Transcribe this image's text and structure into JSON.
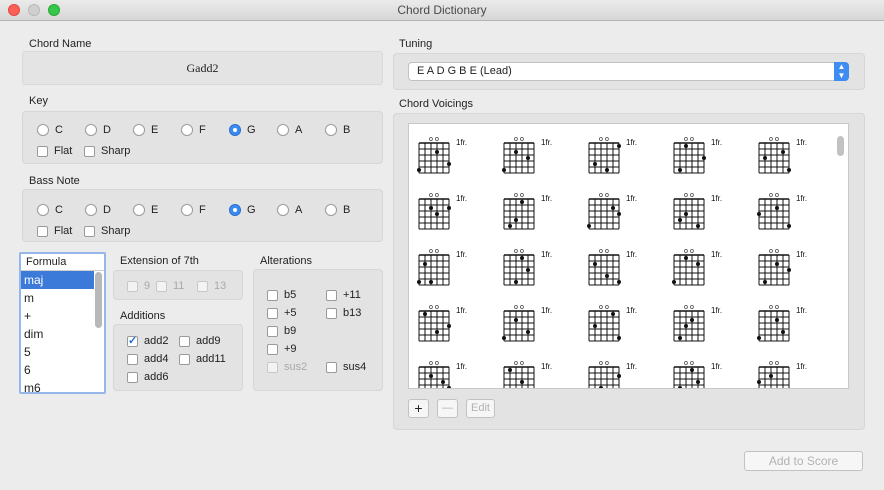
{
  "window": {
    "title": "Chord Dictionary"
  },
  "chord_name": {
    "label": "Chord Name",
    "value": "Gadd2"
  },
  "key": {
    "label": "Key",
    "options": [
      "C",
      "D",
      "E",
      "F",
      "G",
      "A",
      "B"
    ],
    "selected": "G",
    "flat_label": "Flat",
    "sharp_label": "Sharp"
  },
  "bass": {
    "label": "Bass Note",
    "options": [
      "C",
      "D",
      "E",
      "F",
      "G",
      "A",
      "B"
    ],
    "selected": "G",
    "flat_label": "Flat",
    "sharp_label": "Sharp"
  },
  "formula": {
    "header": "Formula",
    "items": [
      "maj",
      "m",
      "+",
      "dim",
      "5",
      "6",
      "m6"
    ],
    "selected": "maj"
  },
  "extension": {
    "label": "Extension of 7th",
    "options": [
      "9",
      "11",
      "13"
    ]
  },
  "additions": {
    "label": "Additions",
    "items": [
      {
        "label": "add2",
        "checked": true
      },
      {
        "label": "add9",
        "checked": false
      },
      {
        "label": "add4",
        "checked": false
      },
      {
        "label": "add11",
        "checked": false
      },
      {
        "label": "add6",
        "checked": false
      }
    ]
  },
  "alterations": {
    "label": "Alterations",
    "items": [
      {
        "label": "b5",
        "disabled": false
      },
      {
        "label": "+11",
        "disabled": false
      },
      {
        "label": "+5",
        "disabled": false
      },
      {
        "label": "b13",
        "disabled": false
      },
      {
        "label": "b9",
        "disabled": false
      },
      {
        "label": "+9",
        "disabled": false
      },
      {
        "label": "sus2",
        "disabled": true
      },
      {
        "label": "sus4",
        "disabled": false
      }
    ]
  },
  "tuning": {
    "label": "Tuning",
    "value": "E A D G B E (Lead)"
  },
  "voicings": {
    "label": "Chord Voicings",
    "fret_label": "1fr.",
    "open_marker": "o"
  },
  "buttons": {
    "add": "+",
    "remove": "—",
    "edit": "Edit",
    "add_to_score": "Add to Score"
  }
}
